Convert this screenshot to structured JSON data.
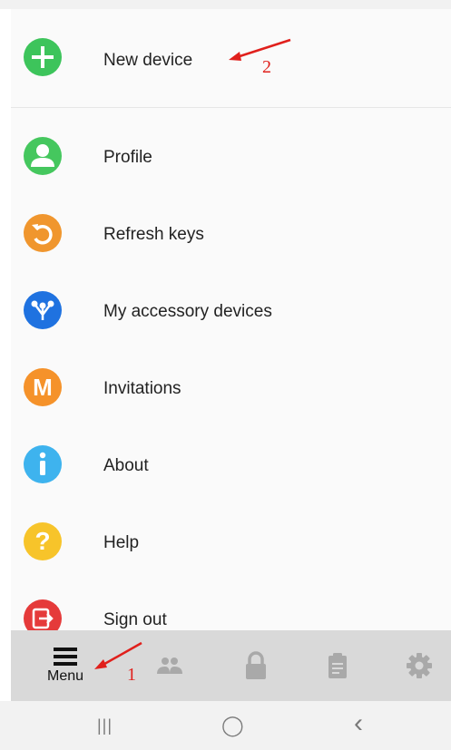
{
  "menu": {
    "new_device": {
      "label": "New device",
      "icon": "plus-icon",
      "color": "#3dc45b"
    },
    "items": [
      {
        "label": "Profile",
        "icon": "person-icon",
        "color": "#45c75e"
      },
      {
        "label": "Refresh keys",
        "icon": "refresh-icon",
        "color": "#f0962e"
      },
      {
        "label": "My accessory devices",
        "icon": "accessory-devices-icon",
        "color": "#1f72e0"
      },
      {
        "label": "Invitations",
        "icon": "letter-m-icon",
        "color": "#f5922a",
        "glyph": "M"
      },
      {
        "label": "About",
        "icon": "info-icon",
        "color": "#3eb3ee"
      },
      {
        "label": "Help",
        "icon": "question-icon",
        "color": "#f7c42a",
        "glyph": "?"
      },
      {
        "label": "Sign out",
        "icon": "sign-out-icon",
        "color": "#e53a3a"
      }
    ]
  },
  "annotations": {
    "one": "1",
    "two": "2",
    "color": "#e0201c"
  },
  "bottom_nav": {
    "menu_label": "Menu",
    "items": [
      "menu-icon",
      "people-icon",
      "lock-icon",
      "clipboard-icon",
      "gear-icon"
    ]
  },
  "system_nav": {
    "recents": "|||",
    "home": "◯",
    "back": "‹"
  }
}
